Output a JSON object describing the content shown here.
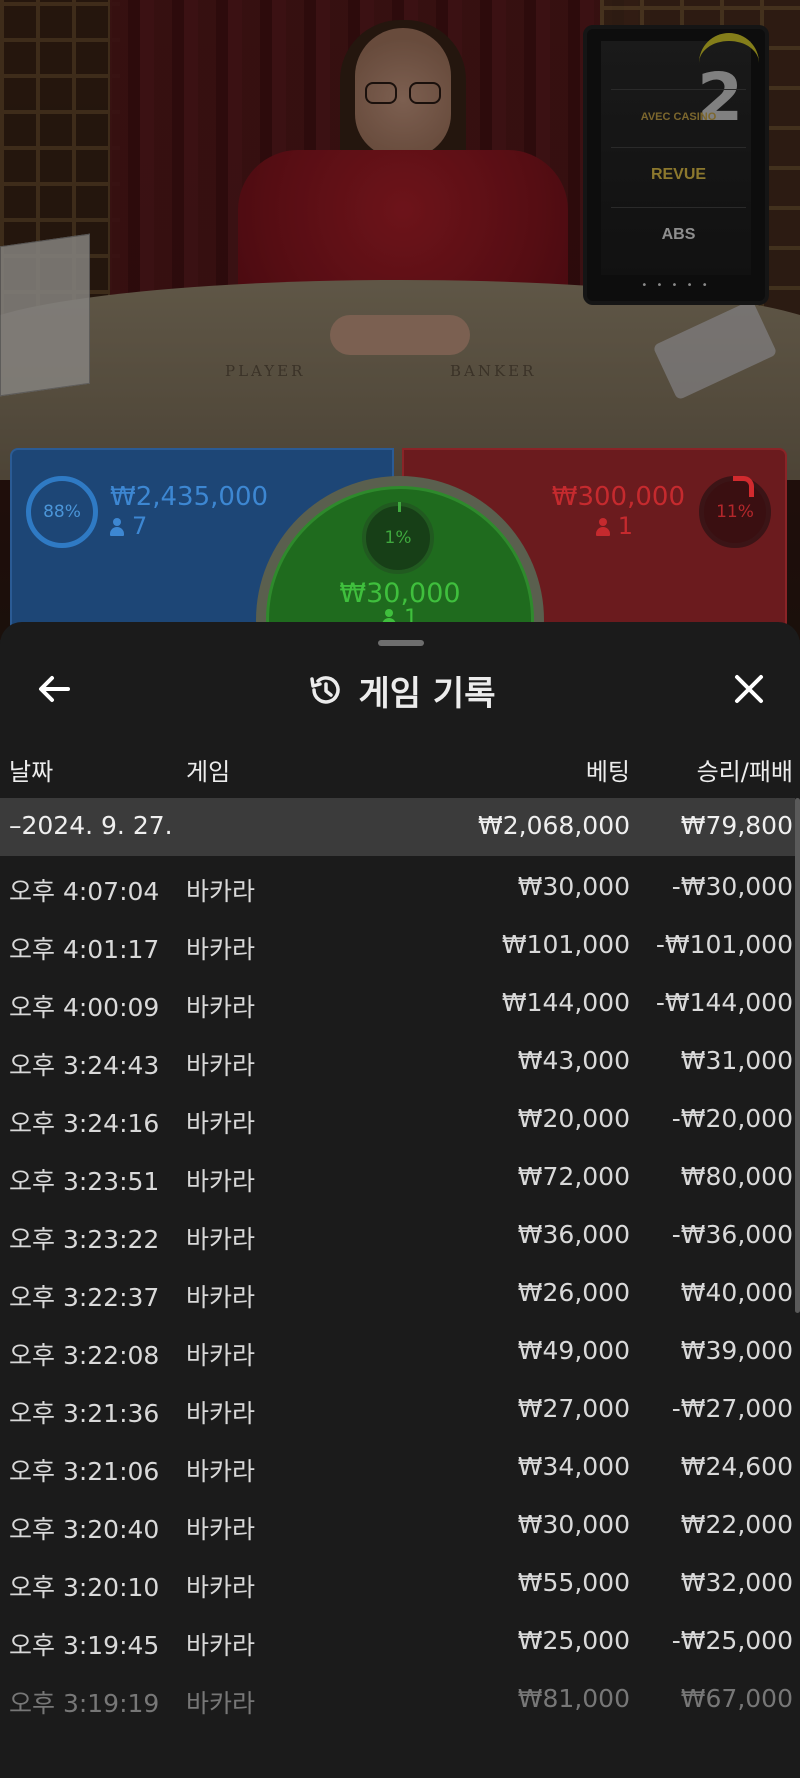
{
  "video": {
    "table_labels": {
      "player": "PLAYER",
      "banker": "BANKER"
    },
    "monitor": {
      "round_number": "2",
      "sponsors": [
        "AVEC CASINO",
        "REVUE",
        "ABS"
      ],
      "dots": "• • • • •"
    }
  },
  "bets": {
    "player": {
      "percent": "88%",
      "amount": "₩2,435,000",
      "players": "7",
      "color": "#3d87d2"
    },
    "banker": {
      "percent": "11%",
      "amount": "₩300,000",
      "players": "1",
      "color": "#c52a2e"
    },
    "tie": {
      "percent": "1%",
      "amount": "₩30,000",
      "players": "1",
      "color": "#3fbf3d"
    }
  },
  "history": {
    "title": "게임 기록",
    "icons": {
      "back": "arrow-left-icon",
      "close": "close-icon",
      "title": "history-icon"
    },
    "columns": {
      "date": "날짜",
      "game": "게임",
      "bet": "베팅",
      "win_loss": "승리/패배"
    },
    "summary": {
      "date": "–2024. 9. 27.",
      "bet": "₩2,068,000",
      "win_loss": "₩79,800"
    },
    "rows": [
      {
        "time": "오후 4:07:04",
        "game": "바카라",
        "bet": "₩30,000",
        "win_loss": "-₩30,000"
      },
      {
        "time": "오후 4:01:17",
        "game": "바카라",
        "bet": "₩101,000",
        "win_loss": "-₩101,000"
      },
      {
        "time": "오후 4:00:09",
        "game": "바카라",
        "bet": "₩144,000",
        "win_loss": "-₩144,000"
      },
      {
        "time": "오후 3:24:43",
        "game": "바카라",
        "bet": "₩43,000",
        "win_loss": "₩31,000"
      },
      {
        "time": "오후 3:24:16",
        "game": "바카라",
        "bet": "₩20,000",
        "win_loss": "-₩20,000"
      },
      {
        "time": "오후 3:23:51",
        "game": "바카라",
        "bet": "₩72,000",
        "win_loss": "₩80,000"
      },
      {
        "time": "오후 3:23:22",
        "game": "바카라",
        "bet": "₩36,000",
        "win_loss": "-₩36,000"
      },
      {
        "time": "오후 3:22:37",
        "game": "바카라",
        "bet": "₩26,000",
        "win_loss": "₩40,000"
      },
      {
        "time": "오후 3:22:08",
        "game": "바카라",
        "bet": "₩49,000",
        "win_loss": "₩39,000"
      },
      {
        "time": "오후 3:21:36",
        "game": "바카라",
        "bet": "₩27,000",
        "win_loss": "-₩27,000"
      },
      {
        "time": "오후 3:21:06",
        "game": "바카라",
        "bet": "₩34,000",
        "win_loss": "₩24,600"
      },
      {
        "time": "오후 3:20:40",
        "game": "바카라",
        "bet": "₩30,000",
        "win_loss": "₩22,000"
      },
      {
        "time": "오후 3:20:10",
        "game": "바카라",
        "bet": "₩55,000",
        "win_loss": "₩32,000"
      },
      {
        "time": "오후 3:19:45",
        "game": "바카라",
        "bet": "₩25,000",
        "win_loss": "-₩25,000"
      },
      {
        "time": "오후 3:19:19",
        "game": "바카라",
        "bet": "₩81,000",
        "win_loss": "₩67,000"
      }
    ]
  }
}
